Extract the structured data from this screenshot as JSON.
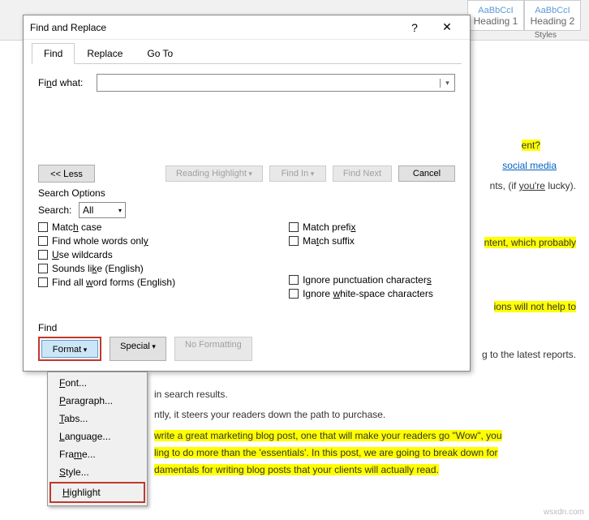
{
  "ribbon": {
    "styles": [
      {
        "preview": "AaBbCcI",
        "name": "Heading 1"
      },
      {
        "preview": "AaBbCcI",
        "name": "Heading 2"
      }
    ],
    "group_label": "Styles"
  },
  "dialog": {
    "title": "Find and Replace",
    "help": "?",
    "close": "✕",
    "tabs": {
      "find": "Find",
      "replace": "Replace",
      "goto": "Go To"
    },
    "find_what_label": "Find what:",
    "find_what_value": "",
    "buttons": {
      "less": "<< Less",
      "reading_highlight": "Reading Highlight",
      "find_in": "Find In",
      "find_next": "Find Next",
      "cancel": "Cancel"
    },
    "search_options_label": "Search Options",
    "search_label": "Search:",
    "search_value": "All",
    "checks_left": [
      "Match case",
      "Find whole words only",
      "Use wildcards",
      "Sounds like (English)",
      "Find all word forms (English)"
    ],
    "checks_right": [
      "Match prefix",
      "Match suffix",
      "Ignore punctuation characters",
      "Ignore white-space characters"
    ],
    "find_section_label": "Find",
    "bottom_buttons": {
      "format": "Format",
      "special": "Special",
      "no_formatting": "No Formatting"
    },
    "format_menu": {
      "items": [
        "Font...",
        "Paragraph...",
        "Tabs...",
        "Language...",
        "Frame...",
        "Style...",
        "Highlight"
      ]
    }
  },
  "document": {
    "lines": [
      {
        "pre": "",
        "hl": "ent?",
        "post": ""
      },
      {
        "pre": "",
        "link": "social media",
        "post": ""
      },
      {
        "pre": "nts, (if ",
        "u": "you're",
        "post": " lucky)."
      },
      {
        "hl_full": "ntent, which probably"
      },
      {
        "hl_full": "ions will not help to"
      },
      {
        "plain": "g to the latest reports."
      },
      {
        "plain": "in search results."
      },
      {
        "plain": "ntly, it steers your readers down the path to purchase."
      },
      {
        "hl_full": " write a great marketing blog post, one that will make your readers go \"Wow\", you"
      },
      {
        "hl_full": "ling to do more than the 'essentials'. In this post, we are going to break down for"
      },
      {
        "hl_full": "damentals for writing blog posts that your clients will actually read."
      }
    ]
  },
  "watermark": "wsxdn.com"
}
